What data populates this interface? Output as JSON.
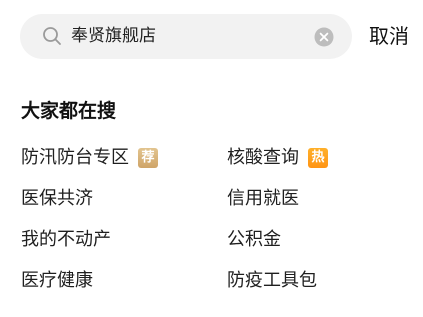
{
  "search": {
    "query": "奉贤旗舰店",
    "cancel_label": "取消"
  },
  "section": {
    "title": "大家都在搜"
  },
  "hot_searches": [
    {
      "label": "防汛防台专区",
      "badge": "荐",
      "badge_color": "#d4aa6e"
    },
    {
      "label": "核酸查询",
      "badge": "热",
      "badge_color": "#ff9f1c"
    },
    {
      "label": "医保共济",
      "badge": null
    },
    {
      "label": "信用就医",
      "badge": null
    },
    {
      "label": "我的不动产",
      "badge": null
    },
    {
      "label": "公积金",
      "badge": null
    },
    {
      "label": "医疗健康",
      "badge": null
    },
    {
      "label": "防疫工具包",
      "badge": null
    }
  ],
  "icons": {
    "search": "search-icon",
    "clear": "clear-icon"
  }
}
